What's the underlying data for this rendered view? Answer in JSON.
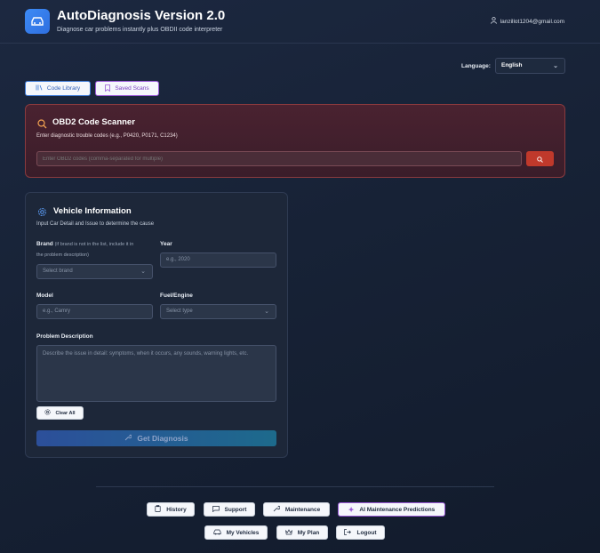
{
  "header": {
    "title": "AutoDiagnosis Version 2.0",
    "subtitle": "Diagnose car problems instantly plus OBDII code interpreter",
    "user_email": "lanzillot1204@gmail.com"
  },
  "language": {
    "label": "Language:",
    "selected": "English"
  },
  "tabs": {
    "code_library": "Code Library",
    "saved_scans": "Saved Scans"
  },
  "scanner": {
    "title": "OBD2 Code Scanner",
    "description": "Enter diagnostic trouble codes (e.g., P0420, P0171, C1234)",
    "input_placeholder": "Enter OBD2 codes (comma-separated for multiple)"
  },
  "vehicle": {
    "title": "Vehicle Information",
    "description": "Input Car Detail and Issue to determine the cause",
    "brand_label": "Brand",
    "brand_note_1": "(if brand is not in the list, include it in",
    "brand_note_2": "the problem description)",
    "brand_placeholder": "Select brand",
    "year_label": "Year",
    "year_placeholder": "e.g., 2020",
    "model_label": "Model",
    "model_placeholder": "e.g., Camry",
    "fuel_label": "Fuel/Engine",
    "fuel_placeholder": "Select type",
    "problem_label": "Problem Description",
    "problem_placeholder": "Describe the issue in detail: symptoms, when it occurs, any sounds, warning lights, etc.",
    "clear_label": "Clear All",
    "diagnose_label": "Get Diagnosis"
  },
  "footer_nav": {
    "history": "History",
    "support": "Support",
    "maintenance": "Maintenance",
    "ai_predictions": "AI Maintenance Predictions",
    "my_vehicles": "My Vehicles",
    "my_plan": "My Plan",
    "logout": "Logout"
  },
  "colors": {
    "accent_blue": "#3e7bd8",
    "accent_purple": "#9a5ad8",
    "scanner_red": "#c0392b",
    "scanner_icon": "#f0a050"
  },
  "icons": {
    "logo": "car-icon",
    "user": "user-icon",
    "code_library": "library-icon",
    "saved_scans": "bookmark-icon",
    "scanner": "search-icon",
    "scan_button": "search-icon",
    "vehicle": "gear-icon",
    "clear": "gear-icon",
    "diagnose": "wrench-icon",
    "history": "clipboard-icon",
    "support": "chat-icon",
    "maintenance": "wrench-icon",
    "ai_predictions": "sparkle-icon",
    "my_vehicles": "car-icon",
    "my_plan": "crown-icon",
    "logout": "logout-icon"
  }
}
